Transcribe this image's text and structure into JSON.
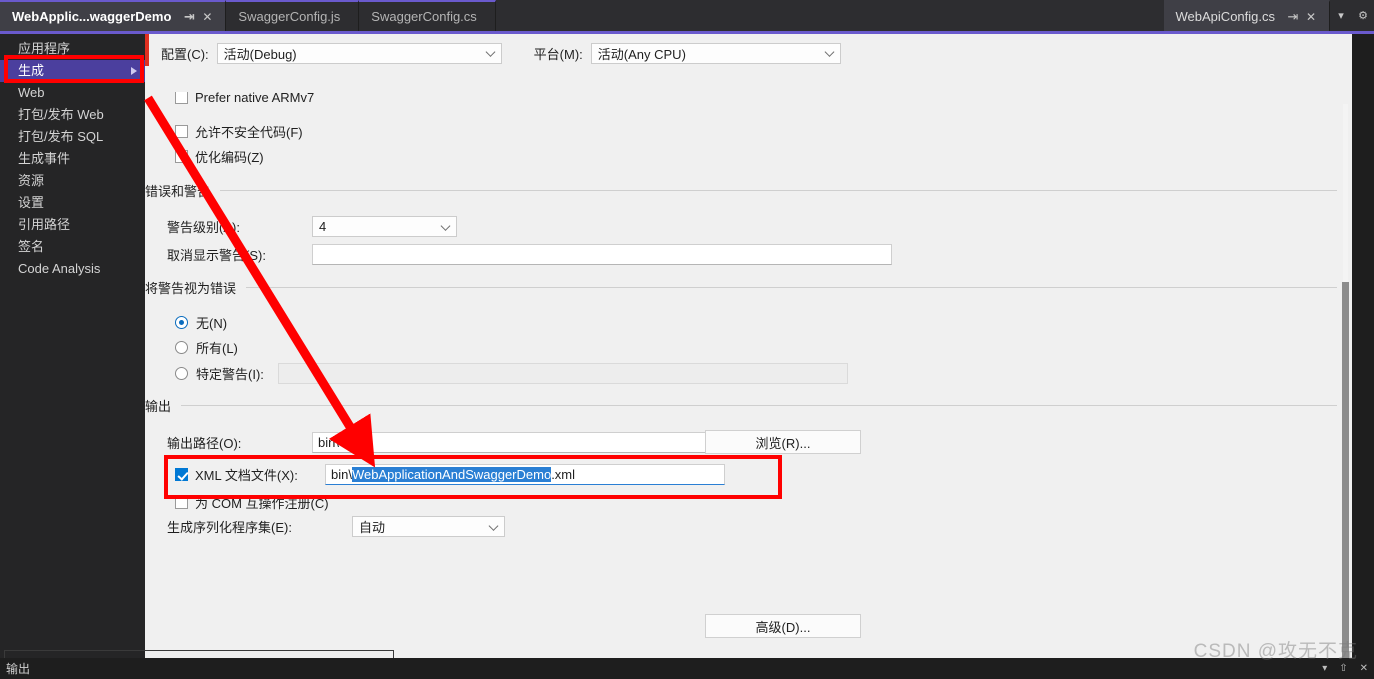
{
  "window": {
    "tabs": [
      {
        "label": "WebApplic...waggerDemo",
        "active": true,
        "pin_icon": "pin-icon",
        "close_icon": "close-icon"
      },
      {
        "label": "SwaggerConfig.js",
        "active": false
      },
      {
        "label": "SwaggerConfig.cs",
        "active": false
      }
    ],
    "right_tabs": [
      {
        "label": "WebApiConfig.cs",
        "pin_icon": "pin-icon",
        "close_icon": "close-icon"
      }
    ],
    "tabstrip_controls": [
      {
        "icon": "chevron-down-icon",
        "name": "tab-list-dropdown"
      },
      {
        "icon": "gear-icon",
        "name": "tab-settings"
      }
    ],
    "accent_color": "#6a5acd"
  },
  "sidebar": {
    "items": [
      {
        "label": "应用程序",
        "selected": false
      },
      {
        "label": "生成",
        "selected": true
      },
      {
        "label": "Web",
        "selected": false
      },
      {
        "label": "打包/发布 Web",
        "selected": false
      },
      {
        "label": "打包/发布 SQL",
        "selected": false
      },
      {
        "label": "生成事件",
        "selected": false
      },
      {
        "label": "资源",
        "selected": false
      },
      {
        "label": "设置",
        "selected": false
      },
      {
        "label": "引用路径",
        "selected": false
      },
      {
        "label": "签名",
        "selected": false
      },
      {
        "label": "Code Analysis",
        "selected": false
      }
    ]
  },
  "config_bar": {
    "configuration_label": "配置(C):",
    "configuration_value": "活动(Debug)",
    "platform_label": "平台(M):",
    "platform_value": "活动(Any CPU)"
  },
  "general_options": {
    "clipped_checkbox_label": "Prefer native ARMv7",
    "checkboxes": [
      {
        "label": "允许不安全代码(F)",
        "checked": false
      },
      {
        "label": "优化编码(Z)",
        "checked": false
      }
    ]
  },
  "errors_warnings": {
    "group_title": "错误和警告",
    "warning_level_label": "警告级别(A):",
    "warning_level_value": "4",
    "suppress_warnings_label": "取消显示警告(S):",
    "suppress_warnings_value": ""
  },
  "treat_warnings": {
    "group_title": "将警告视为错误",
    "options": [
      {
        "label": "无(N)",
        "selected": true
      },
      {
        "label": "所有(L)",
        "selected": false
      },
      {
        "label": "特定警告(I):",
        "selected": false
      }
    ],
    "specific_warnings_value": ""
  },
  "output": {
    "group_title": "输出",
    "output_path_label": "输出路径(O):",
    "output_path_value": "bin\\",
    "browse_button": "浏览(R)...",
    "xml_doc_label": "XML 文档文件(X):",
    "xml_doc_checked": true,
    "xml_doc_prefix": "bin\\",
    "xml_doc_selected": "WebApplicationAndSwaggerDemo",
    "xml_doc_suffix": ".xml",
    "com_interop_label": "为 COM 互操作注册(C)",
    "com_interop_checked": false,
    "serialization_label": "生成序列化程序集(E):",
    "serialization_value": "自动",
    "advanced_button": "高级(D)..."
  },
  "status_bar": {
    "label": "输出",
    "icons": [
      "chevron-down-icon",
      "pin-icon",
      "close-icon"
    ]
  },
  "watermark": "CSDN @攻无不克",
  "annotations": {
    "highlight_color": "#ff0000",
    "boxes": [
      {
        "name": "sidebar-build-highlight"
      },
      {
        "name": "xml-doc-file-highlight"
      }
    ],
    "arrow": {
      "name": "callout-arrow",
      "from": "sidebar-build",
      "to": "xml-doc-file-row"
    }
  }
}
